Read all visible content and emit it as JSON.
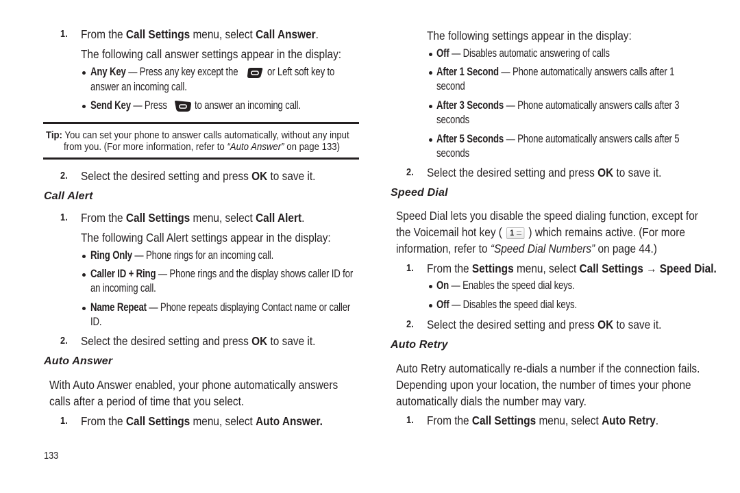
{
  "left_column": {
    "call_answer_step1": {
      "num": "1.",
      "pre": "From the ",
      "b1": "Call Settings",
      "mid": " menu, select ",
      "b2": "Call Answer",
      "post": "."
    },
    "call_answer_intro": "The following call answer settings appear in the display:",
    "call_answer_options": [
      {
        "term": "Any Key",
        "desc_before_icon": " — Press any key except the ",
        "icon": "end-key-icon",
        "desc_after_icon": " or Left soft key to",
        "desc_line2": "answer an incoming call."
      },
      {
        "term": "Send Key",
        "desc_before_icon": " — Press ",
        "icon": "send-key-icon",
        "desc_after_icon": " to answer an incoming call."
      }
    ],
    "tip": {
      "label": "Tip:",
      "line1": " You can set your phone to answer calls automatically, without any input",
      "line2_pre": "from you. (For more information, refer to ",
      "line2_ref": "“Auto Answer”",
      "line2_post": "  on page 133)"
    },
    "call_answer_step2": {
      "num": "2.",
      "pre": "Select the desired setting and press ",
      "b": "OK",
      "post": " to save it."
    },
    "call_alert_heading": "Call Alert",
    "call_alert_step1": {
      "num": "1.",
      "pre": "From the ",
      "b1": "Call Settings",
      "mid": " menu, select ",
      "b2": "Call Alert",
      "post": "."
    },
    "call_alert_intro": "The following Call Alert settings appear in the display:",
    "call_alert_options": [
      {
        "term": "Ring Only",
        "desc": " — Phone rings for an incoming call."
      },
      {
        "term": "Caller ID + Ring",
        "desc": " — Phone rings and the display shows caller ID for",
        "desc_line2": "an incoming call."
      },
      {
        "term": "Name Repeat",
        "desc": " — Phone repeats displaying Contact name or caller",
        "desc_line2": "ID."
      }
    ],
    "call_alert_step2": {
      "num": "2.",
      "pre": "Select the desired setting and press ",
      "b": "OK",
      "post": " to save it."
    },
    "auto_answer_heading": "Auto Answer",
    "auto_answer_para_line1": "With Auto Answer enabled, your phone automatically answers",
    "auto_answer_para_line2": "calls after a period of time that you select.",
    "auto_answer_step1": {
      "num": "1.",
      "pre": "From the ",
      "b1": "Call Settings",
      "mid": " menu, select ",
      "b2": "Auto Answer."
    },
    "page_number": "133"
  },
  "right_column": {
    "auto_answer_intro": "The following settings appear in the display:",
    "auto_answer_options": [
      {
        "term": "Off",
        "desc": " — Disables automatic answering of calls"
      },
      {
        "term": "After 1 Second",
        "desc": " — Phone automatically answers calls after 1",
        "desc_line2": "second"
      },
      {
        "term": "After 3 Seconds",
        "desc": " — Phone automatically answers calls after 3",
        "desc_line2": "seconds"
      },
      {
        "term": "After 5 Seconds",
        "desc": " — Phone automatically answers calls after 5",
        "desc_line2": "seconds"
      }
    ],
    "auto_answer_step2": {
      "num": "2.",
      "pre": "Select the desired setting and press ",
      "b": "OK",
      "post": " to save it."
    },
    "speed_dial_heading": "Speed Dial",
    "speed_dial_para_line1": "Speed Dial lets you disable the speed dialing function, except for",
    "speed_dial_para_line2_pre": "the Voicemail hot key ( ",
    "speed_dial_key_label": "1",
    "speed_dial_para_line2_post": " ) which remains active. (For more",
    "speed_dial_para_line3_pre": "information, refer to ",
    "speed_dial_para_line3_ref": "“Speed Dial Numbers”",
    "speed_dial_para_line3_post": "  on page 44.)",
    "speed_dial_step1": {
      "num": "1.",
      "pre": "From the ",
      "b1": "Settings",
      "mid": " menu, select ",
      "b2": "Call Settings → Speed Dial."
    },
    "speed_dial_options": [
      {
        "term": "On",
        "desc": " — Enables the speed dial keys."
      },
      {
        "term": "Off",
        "desc": " — Disables the speed dial keys."
      }
    ],
    "speed_dial_step2": {
      "num": "2.",
      "pre": "Select the desired setting and press ",
      "b": "OK",
      "post": " to save it."
    },
    "auto_retry_heading": "Auto Retry",
    "auto_retry_para_line1": "Auto Retry automatically re-dials a number if the connection fails.",
    "auto_retry_para_line2": "Depending upon your location, the number of times your phone",
    "auto_retry_para_line3": "automatically dials the number may vary.",
    "auto_retry_step1": {
      "num": "1.",
      "pre": "From the ",
      "b1": "Call Settings",
      "mid": " menu, select ",
      "b2": "Auto Retry",
      "post": "."
    }
  }
}
